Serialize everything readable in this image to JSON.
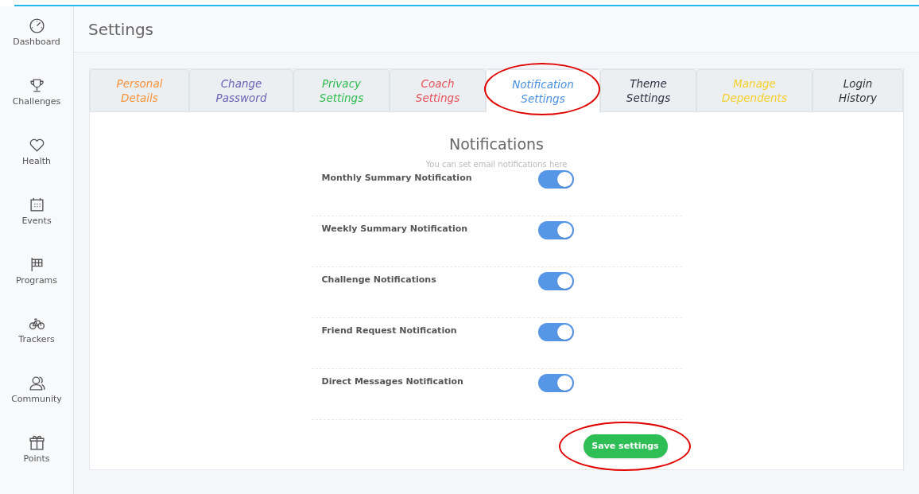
{
  "sidebar": {
    "items": [
      {
        "label": "Dashboard",
        "kind": "gauge"
      },
      {
        "label": "Challenges",
        "kind": "trophy"
      },
      {
        "label": "Health",
        "kind": "heart"
      },
      {
        "label": "Events",
        "kind": "calendar"
      },
      {
        "label": "Programs",
        "kind": "flag"
      },
      {
        "label": "Trackers",
        "kind": "bike"
      },
      {
        "label": "Community",
        "kind": "people"
      },
      {
        "label": "Points",
        "kind": "gift"
      }
    ]
  },
  "header": {
    "title": "Settings"
  },
  "tabs": [
    {
      "label": "Personal Details",
      "color": "#f7913a",
      "selected": false,
      "circled": false
    },
    {
      "label": "Change Password",
      "color": "#6b5fb5",
      "selected": false,
      "circled": false
    },
    {
      "label": "Privacy Settings",
      "color": "#2dbb4f",
      "selected": false,
      "circled": false
    },
    {
      "label": "Coach Settings",
      "color": "#e8505b",
      "selected": false,
      "circled": false
    },
    {
      "label": "Notification Settings",
      "color": "#4a90e2",
      "selected": true,
      "circled": true
    },
    {
      "label": "Theme Settings",
      "color": "#2d3142",
      "selected": false,
      "circled": false
    },
    {
      "label": "Manage Dependents",
      "color": "#f5cf2b",
      "selected": false,
      "circled": false
    },
    {
      "label": "Login History",
      "color": "#333333",
      "selected": false,
      "circled": false
    }
  ],
  "notifications": {
    "title": "Notifications",
    "subtitle": "You can set email notifications here",
    "items": [
      {
        "label": "Monthly Summary Notification",
        "on": true
      },
      {
        "label": "Weekly Summary Notification",
        "on": true
      },
      {
        "label": "Challenge Notifications",
        "on": true
      },
      {
        "label": "Friend Request Notification",
        "on": true
      },
      {
        "label": "Direct Messages Notification",
        "on": true
      }
    ]
  },
  "save_button": {
    "label": "Save settings",
    "circled": true
  }
}
